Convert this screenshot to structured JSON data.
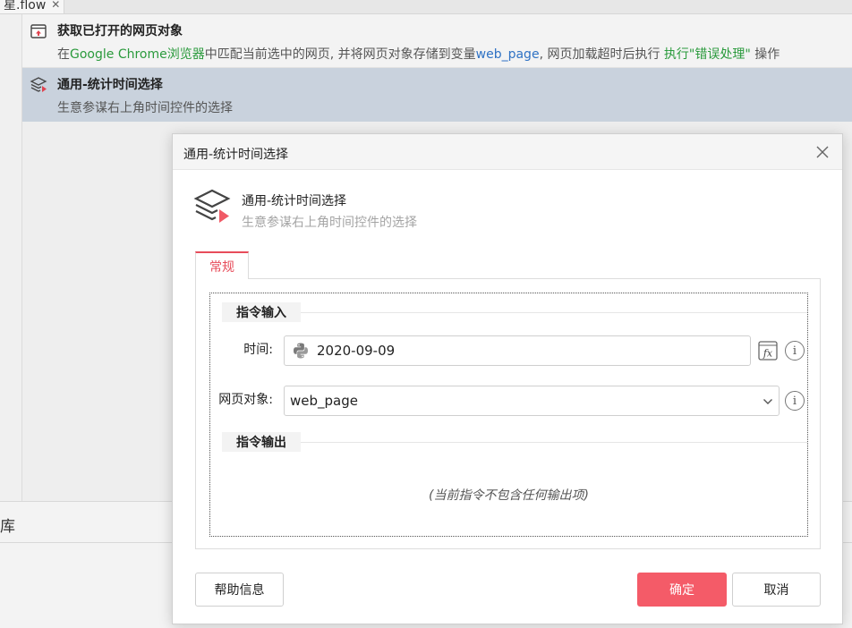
{
  "background": {
    "tab_label": "星.flow",
    "tab_close": "✕",
    "steps": [
      {
        "title": "获取已打开的网页对象",
        "desc_parts": [
          "在",
          "Google Chrome浏览器",
          "中匹配当前选中的网页, 并将网页对象存储到变量",
          "web_page",
          ", 网页加载超时后执行 ",
          "执行\"错误处理\"",
          " 操作"
        ]
      },
      {
        "title": "通用-统计时间选择",
        "desc": "生意参谋右上角时间控件的选择"
      }
    ],
    "library_label": "库"
  },
  "dialog": {
    "title": "通用-统计时间选择",
    "header_name": "通用-统计时间选择",
    "header_desc": "生意参谋右上角时间控件的选择",
    "tab_general": "常规",
    "section_input": "指令输入",
    "time_label": "时间:",
    "time_value": "2020-09-09",
    "webobj_label": "网页对象:",
    "webobj_value": "web_page",
    "section_output": "指令输出",
    "no_output": "(当前指令不包含任何输出项)",
    "help_button": "帮助信息",
    "ok_button": "确定",
    "cancel_button": "取消",
    "info_glyph": "i"
  },
  "colors": {
    "accent": "#f45b68",
    "tab_accent": "#e74c5a",
    "selected_row": "#c9d2dd",
    "green_text": "#2a9a3c",
    "blue_text": "#2f72c4"
  }
}
